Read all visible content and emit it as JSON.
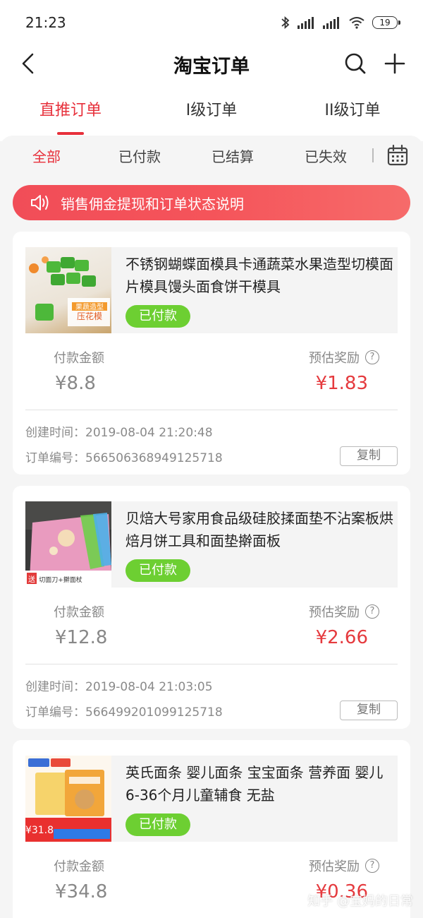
{
  "status": {
    "time": "21:23",
    "battery": "19"
  },
  "header": {
    "title": "淘宝订单"
  },
  "tabs": [
    {
      "label": "直推订单",
      "active": true
    },
    {
      "label": "I级订单",
      "active": false
    },
    {
      "label": "II级订单",
      "active": false
    }
  ],
  "filters": [
    {
      "label": "全部",
      "active": true
    },
    {
      "label": "已付款",
      "active": false
    },
    {
      "label": "已结算",
      "active": false
    },
    {
      "label": "已失效",
      "active": false
    }
  ],
  "notice": {
    "text": "销售佣金提现和订单状态说明"
  },
  "labels": {
    "pay_amount": "付款金额",
    "est_reward": "预估奖励",
    "copy": "复制"
  },
  "orders": [
    {
      "title": "不锈钢蝴蝶面模具卡通蔬菜水果造型切模面片模具馒头面食饼干模具",
      "status": "已付款",
      "thumb_text": "果蔬造型\n压花模",
      "pay": "¥8.8",
      "reward": "¥1.83",
      "created": "创建时间：2019-08-04 21:20:48",
      "order_no": "订单编号：566506368949125718"
    },
    {
      "title": "贝焙大号家用食品级硅胶揉面垫不沾案板烘焙月饼工具和面垫擀面板",
      "status": "已付款",
      "thumb_text": "送 切面刀+擀面杖",
      "pay": "¥12.8",
      "reward": "¥2.66",
      "created": "创建时间：2019-08-04 21:03:05",
      "order_no": "订单编号：566499201099125718"
    },
    {
      "title": "英氏面条 婴儿面条 宝宝面条 营养面 婴儿 6-36个月儿童辅食 无盐",
      "status": "已付款",
      "thumb_text": "¥31.8",
      "pay": "¥34.8",
      "reward": "¥0.36"
    }
  ],
  "watermark": "知乎 @宝妈的日常",
  "colors": {
    "accent": "#e7303b",
    "paid_badge": "#6dcf32",
    "reward": "#e53a3e"
  }
}
